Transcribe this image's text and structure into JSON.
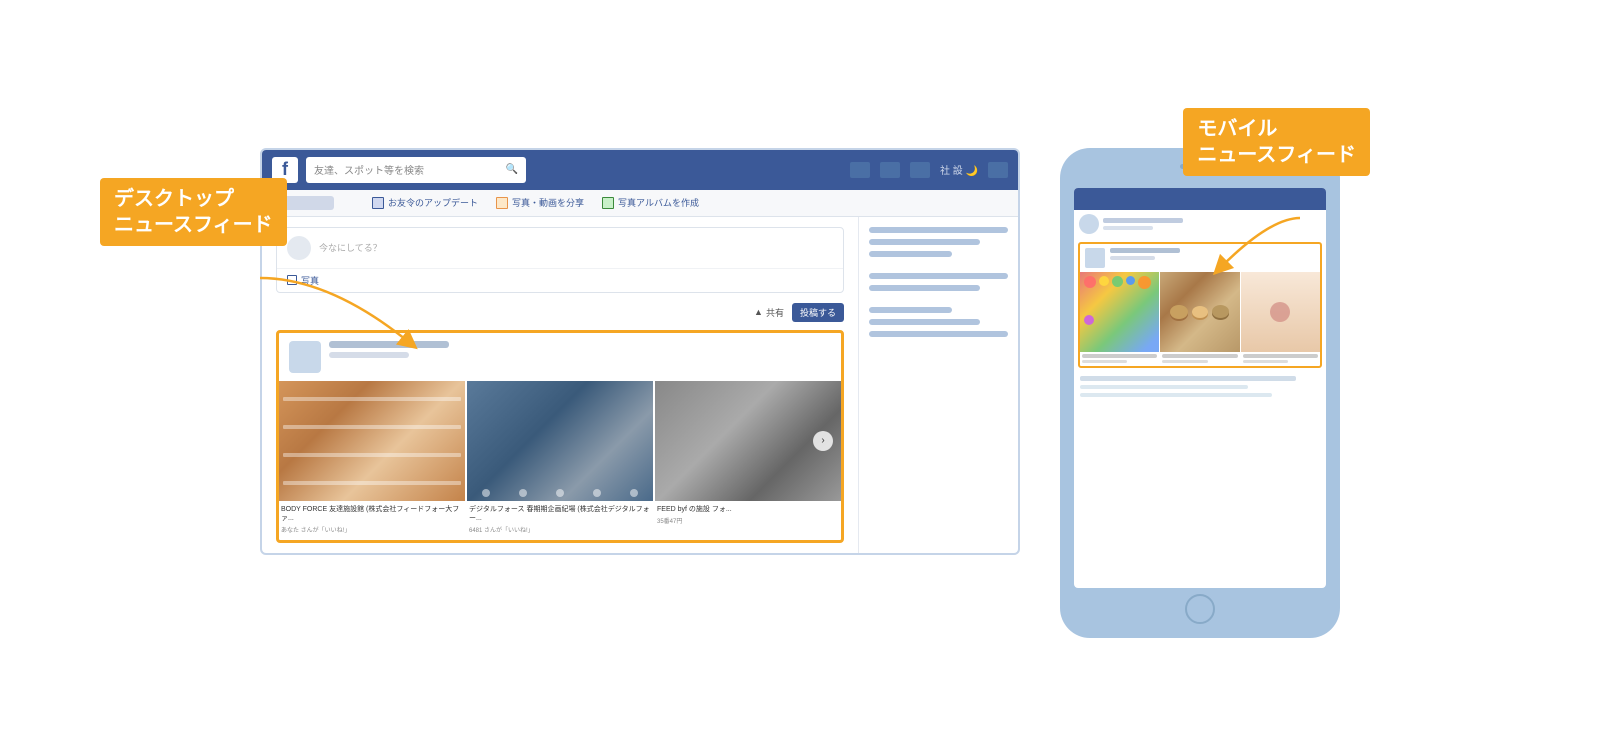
{
  "labels": {
    "desktop_label_line1": "デスクトップ",
    "desktop_label_line2": "ニュースフィード",
    "mobile_label_line1": "モバイル",
    "mobile_label_line2": "ニュースフィード"
  },
  "facebook": {
    "logo": "f",
    "search_placeholder": "友達、スポット等を検索",
    "toolbar_items": [
      "お友令のアップデート",
      "写真・動画を分享",
      "写真アルバムを作成"
    ],
    "post_placeholder": "今なにしてる？",
    "btn_share_label": "共有",
    "btn_post_label": "投稿する",
    "photo_captions": [
      {
        "title": "BODY FORCE 友達施設館 (株式会社フィードフォー大ファ...",
        "sub": "あなた さんが「いいね!」"
      },
      {
        "title": "デジタルフォース 春期期企画紀場 (株式会社デジタルフォー...",
        "sub": "6481 さんが「いいね!」"
      },
      {
        "title": "FEED byf の施設 フォ...",
        "sub": "35番47円"
      }
    ]
  },
  "icons": {
    "search": "🔍",
    "chevron_right": "›",
    "photo": "📷",
    "album": "📁",
    "update": "✓"
  }
}
